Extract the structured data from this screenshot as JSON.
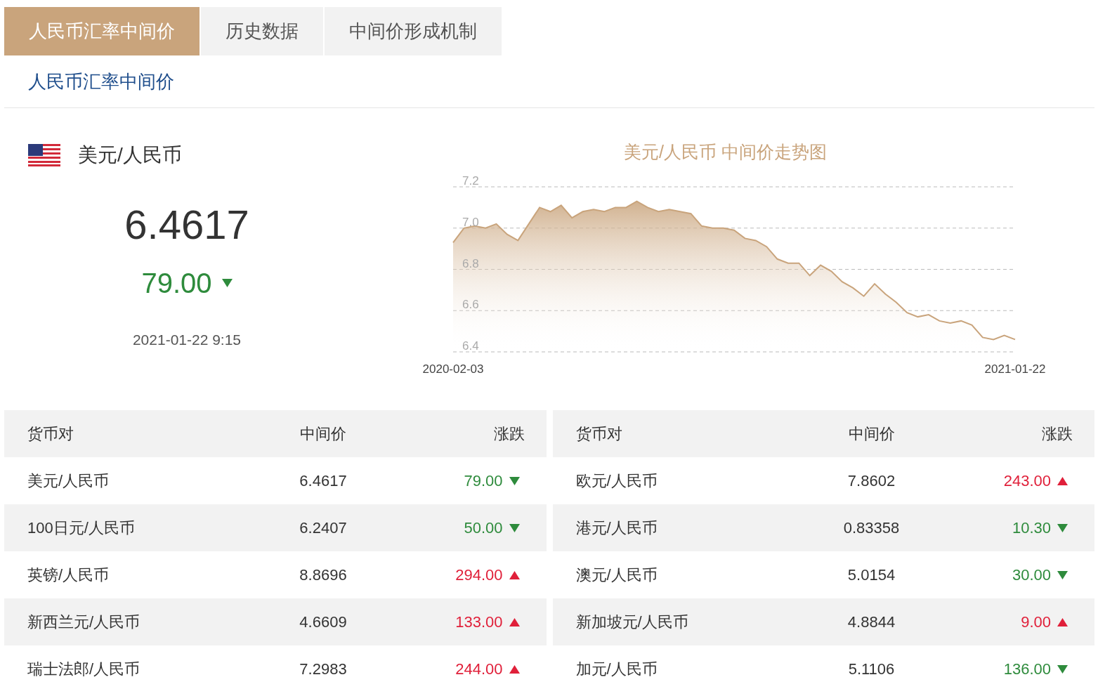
{
  "tabs": [
    {
      "label": "人民币汇率中间价",
      "selected": true
    },
    {
      "label": "历史数据",
      "selected": false
    },
    {
      "label": "中间价形成机制",
      "selected": false
    }
  ],
  "section_title": "人民币汇率中间价",
  "quote": {
    "pair": "美元/人民币",
    "rate": "6.4617",
    "change": "79.00",
    "kind": "down",
    "time": "2021-01-22 9:15"
  },
  "chart": {
    "title": "美元/人民币 中间价走势图",
    "start_date": "2020-02-03",
    "end_date": "2021-01-22",
    "chart_data": {
      "type": "area",
      "grid": true,
      "ylim": [
        6.4,
        7.2
      ],
      "yticks": [
        {
          "value": 6.4,
          "label": "6.4"
        },
        {
          "value": 6.6,
          "label": "6.6"
        },
        {
          "value": 6.8,
          "label": "6.8"
        },
        {
          "value": 7,
          "label": "7.0"
        },
        {
          "value": 7.2,
          "label": "7.2"
        }
      ],
      "series": [
        {
          "color": "#c9a47c",
          "values": [
            6.93,
            7.0,
            7.01,
            7.0,
            7.02,
            6.97,
            6.94,
            7.02,
            7.1,
            7.08,
            7.11,
            7.05,
            7.08,
            7.09,
            7.08,
            7.1,
            7.1,
            7.13,
            7.1,
            7.08,
            7.09,
            7.08,
            7.07,
            7.01,
            7.0,
            7.0,
            6.99,
            6.95,
            6.94,
            6.91,
            6.85,
            6.83,
            6.83,
            6.77,
            6.82,
            6.79,
            6.74,
            6.71,
            6.67,
            6.73,
            6.68,
            6.64,
            6.59,
            6.57,
            6.58,
            6.55,
            6.54,
            6.55,
            6.53,
            6.47,
            6.46,
            6.48,
            6.46
          ]
        }
      ]
    }
  },
  "tables": [
    {
      "columns": [
        "货币对",
        "中间价",
        "涨跌"
      ],
      "rows": [
        {
          "pair": "美元/人民币",
          "rate": "6.4617",
          "change": "79.00",
          "kind": "down"
        },
        {
          "pair": "100日元/人民币",
          "rate": "6.2407",
          "change": "50.00",
          "kind": "down"
        },
        {
          "pair": "英镑/人民币",
          "rate": "8.8696",
          "change": "294.00",
          "kind": "up"
        },
        {
          "pair": "新西兰元/人民币",
          "rate": "4.6609",
          "change": "133.00",
          "kind": "up"
        },
        {
          "pair": "瑞士法郎/人民币",
          "rate": "7.2983",
          "change": "244.00",
          "kind": "up"
        }
      ]
    },
    {
      "columns": [
        "货币对",
        "中间价",
        "涨跌"
      ],
      "rows": [
        {
          "pair": "欧元/人民币",
          "rate": "7.8602",
          "change": "243.00",
          "kind": "up"
        },
        {
          "pair": "港元/人民币",
          "rate": "0.83358",
          "change": "10.30",
          "kind": "down"
        },
        {
          "pair": "澳元/人民币",
          "rate": "5.0154",
          "change": "30.00",
          "kind": "down"
        },
        {
          "pair": "新加坡元/人民币",
          "rate": "4.8844",
          "change": "9.00",
          "kind": "up"
        },
        {
          "pair": "加元/人民币",
          "rate": "5.1106",
          "change": "136.00",
          "kind": "down"
        }
      ]
    }
  ]
}
